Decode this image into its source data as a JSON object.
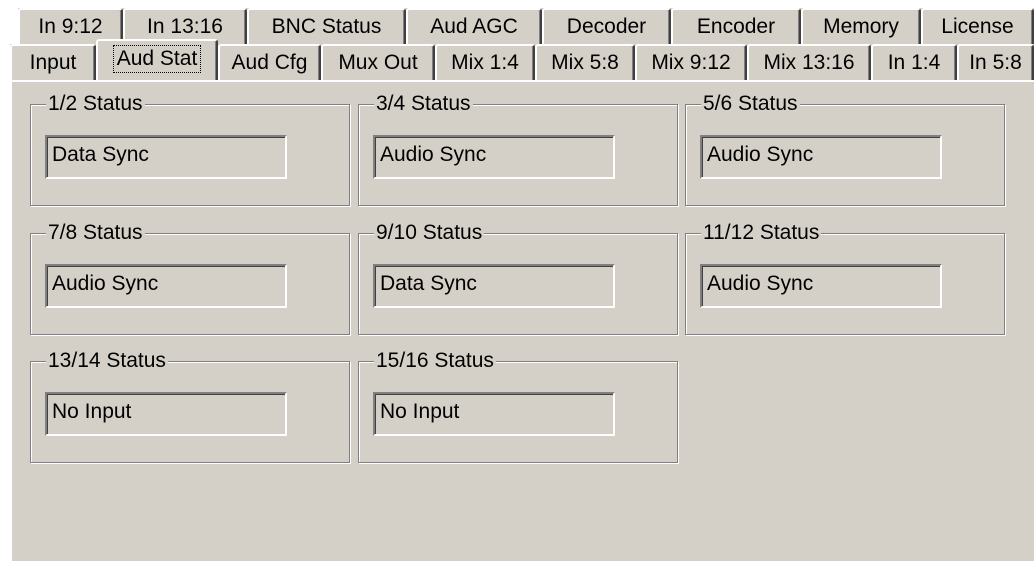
{
  "tabs_top": [
    {
      "label": "In 9:12"
    },
    {
      "label": "In 13:16"
    },
    {
      "label": "BNC Status"
    },
    {
      "label": "Aud AGC"
    },
    {
      "label": "Decoder"
    },
    {
      "label": "Encoder"
    },
    {
      "label": "Memory"
    },
    {
      "label": "License"
    }
  ],
  "tabs_bottom": [
    {
      "label": "Input"
    },
    {
      "label": "Aud Stat",
      "active": true
    },
    {
      "label": "Aud Cfg"
    },
    {
      "label": "Mux Out"
    },
    {
      "label": "Mix 1:4"
    },
    {
      "label": "Mix 5:8"
    },
    {
      "label": "Mix 9:12"
    },
    {
      "label": "Mix 13:16"
    },
    {
      "label": "In 1:4"
    },
    {
      "label": "In 5:8"
    }
  ],
  "groups": [
    {
      "title": "1/2 Status",
      "value": "Data Sync"
    },
    {
      "title": "3/4 Status",
      "value": "Audio Sync"
    },
    {
      "title": "5/6 Status",
      "value": "Audio Sync"
    },
    {
      "title": "7/8 Status",
      "value": "Audio Sync"
    },
    {
      "title": "9/10 Status",
      "value": "Data Sync"
    },
    {
      "title": "11/12 Status",
      "value": "Audio Sync"
    },
    {
      "title": "13/14 Status",
      "value": "No Input"
    },
    {
      "title": "15/16 Status",
      "value": "No Input"
    }
  ]
}
